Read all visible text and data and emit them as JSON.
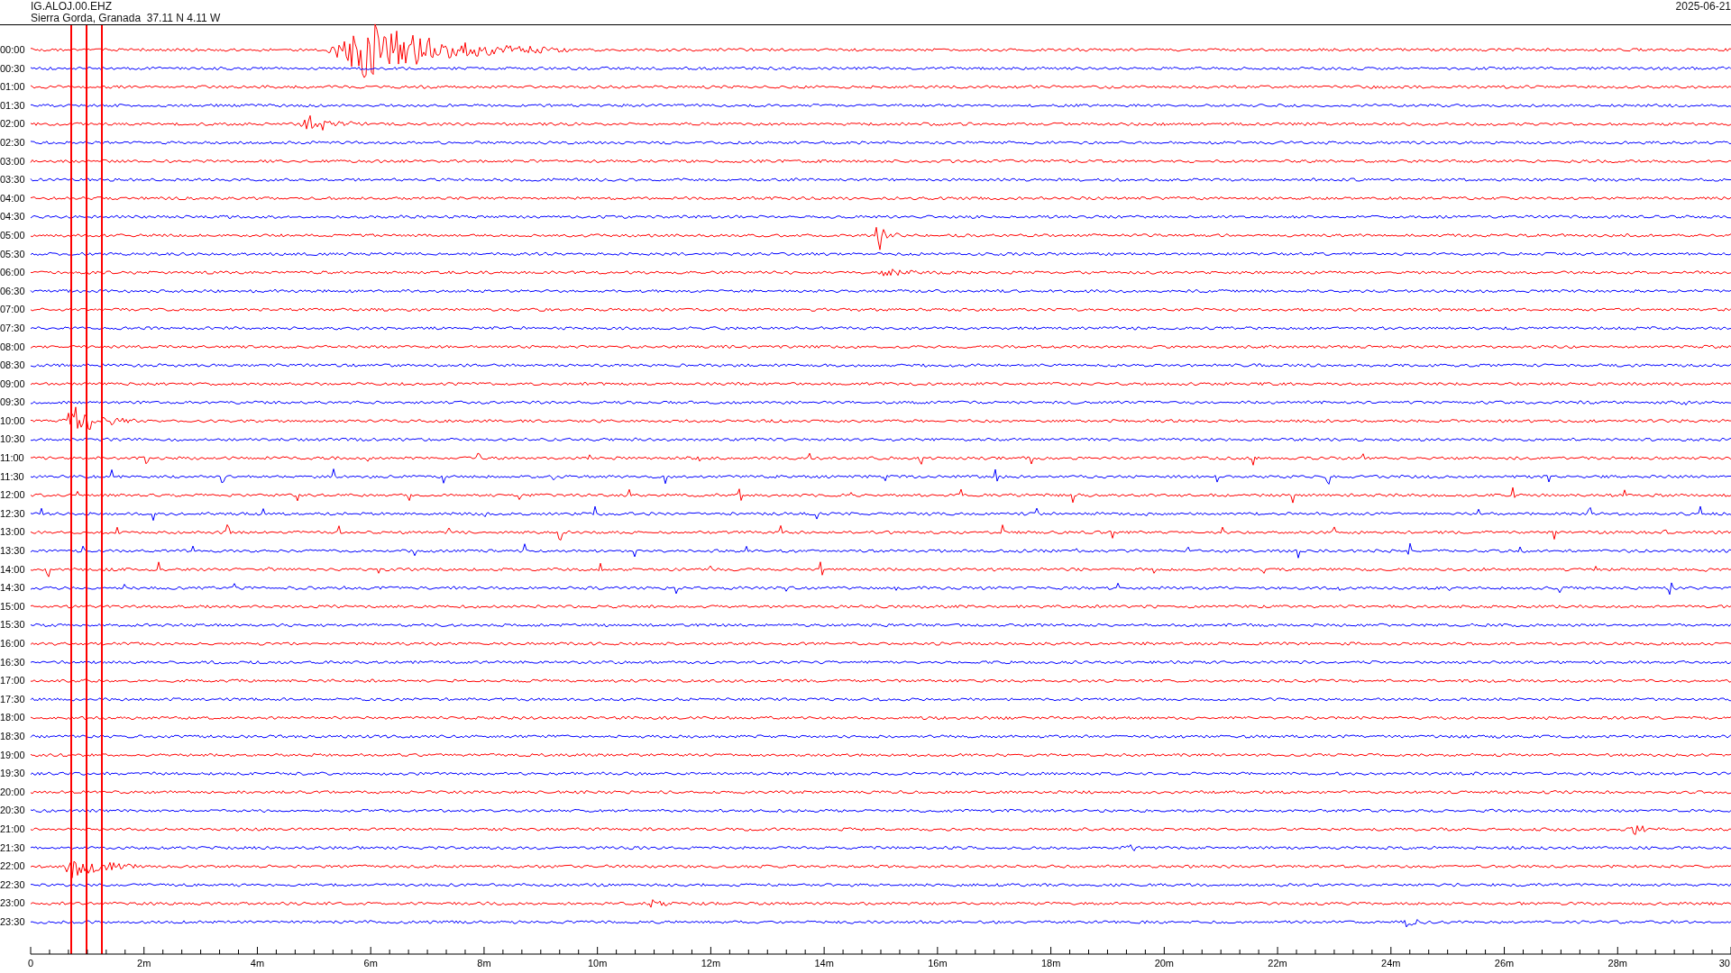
{
  "header": {
    "station": "IG.ALOJ.00.EHZ",
    "location": "Sierra Gorda, Granada  37.11 N 4.11 W",
    "date": "2025-06-21"
  },
  "traces": [
    {
      "label": "00:00",
      "color": "#ff0000"
    },
    {
      "label": "00:30",
      "color": "#0000ff"
    },
    {
      "label": "01:00",
      "color": "#ff0000"
    },
    {
      "label": "01:30",
      "color": "#0000ff"
    },
    {
      "label": "02:00",
      "color": "#ff0000"
    },
    {
      "label": "02:30",
      "color": "#0000ff"
    },
    {
      "label": "03:00",
      "color": "#ff0000"
    },
    {
      "label": "03:30",
      "color": "#0000ff"
    },
    {
      "label": "04:00",
      "color": "#ff0000"
    },
    {
      "label": "04:30",
      "color": "#0000ff"
    },
    {
      "label": "05:00",
      "color": "#ff0000"
    },
    {
      "label": "05:30",
      "color": "#0000ff"
    },
    {
      "label": "06:00",
      "color": "#ff0000"
    },
    {
      "label": "06:30",
      "color": "#0000ff"
    },
    {
      "label": "07:00",
      "color": "#ff0000"
    },
    {
      "label": "07:30",
      "color": "#0000ff"
    },
    {
      "label": "08:00",
      "color": "#ff0000"
    },
    {
      "label": "08:30",
      "color": "#0000ff"
    },
    {
      "label": "09:00",
      "color": "#ff0000"
    },
    {
      "label": "09:30",
      "color": "#0000ff"
    },
    {
      "label": "10:00",
      "color": "#ff0000"
    },
    {
      "label": "10:30",
      "color": "#0000ff"
    },
    {
      "label": "11:00",
      "color": "#ff0000"
    },
    {
      "label": "11:30",
      "color": "#0000ff"
    },
    {
      "label": "12:00",
      "color": "#ff0000"
    },
    {
      "label": "12:30",
      "color": "#0000ff"
    },
    {
      "label": "13:00",
      "color": "#ff0000"
    },
    {
      "label": "13:30",
      "color": "#0000ff"
    },
    {
      "label": "14:00",
      "color": "#ff0000"
    },
    {
      "label": "14:30",
      "color": "#0000ff"
    },
    {
      "label": "15:00",
      "color": "#ff0000"
    },
    {
      "label": "15:30",
      "color": "#0000ff"
    },
    {
      "label": "16:00",
      "color": "#ff0000"
    },
    {
      "label": "16:30",
      "color": "#0000ff"
    },
    {
      "label": "17:00",
      "color": "#ff0000"
    },
    {
      "label": "17:30",
      "color": "#0000ff"
    },
    {
      "label": "18:00",
      "color": "#ff0000"
    },
    {
      "label": "18:30",
      "color": "#0000ff"
    },
    {
      "label": "19:00",
      "color": "#ff0000"
    },
    {
      "label": "19:30",
      "color": "#0000ff"
    },
    {
      "label": "20:00",
      "color": "#ff0000"
    },
    {
      "label": "20:30",
      "color": "#0000ff"
    },
    {
      "label": "21:00",
      "color": "#ff0000"
    },
    {
      "label": "21:30",
      "color": "#0000ff"
    },
    {
      "label": "22:00",
      "color": "#ff0000"
    },
    {
      "label": "22:30",
      "color": "#0000ff"
    },
    {
      "label": "23:00",
      "color": "#ff0000"
    },
    {
      "label": "23:30",
      "color": "#0000ff"
    }
  ],
  "x_axis": {
    "ticks": [
      "0",
      "2m",
      "4m",
      "6m",
      "8m",
      "10m",
      "12m",
      "14m",
      "16m",
      "18m",
      "20m",
      "22m",
      "24m",
      "26m",
      "28m",
      "30"
    ]
  }
}
